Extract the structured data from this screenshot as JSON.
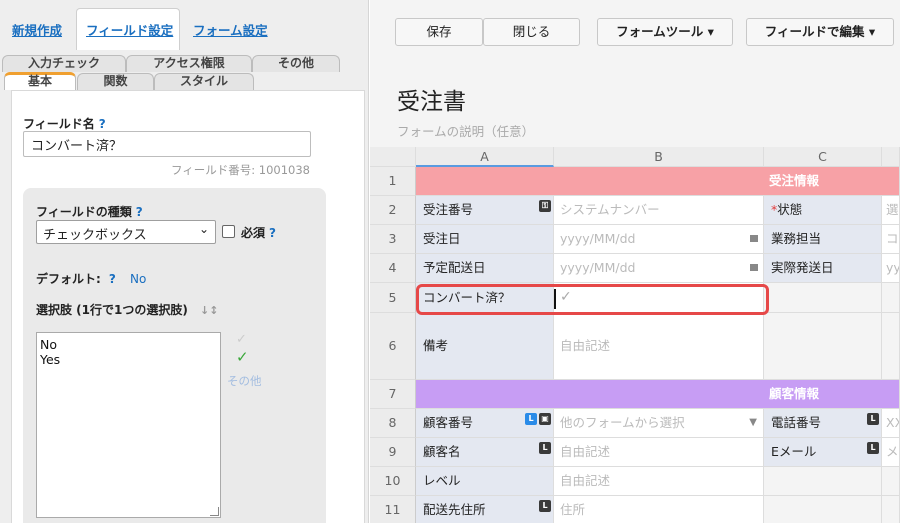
{
  "nav": {
    "new": "新規作成",
    "field_settings": "フィールド設定",
    "form_settings": "フォーム設定"
  },
  "tabs": {
    "input_check": "入力チェック",
    "access": "アクセス権限",
    "other": "その他",
    "basic": "基本",
    "function": "関数",
    "style": "スタイル"
  },
  "field": {
    "name_label": "フィールド名",
    "help": "?",
    "name_value": "コンバート済？",
    "number_text": "フィールド番号: 1001038",
    "type_label": "フィールドの種類",
    "type_value": "チェックボックス",
    "required_label": "必須",
    "default_label": "デフォルト:",
    "default_value": "No",
    "choices_label": "選択肢 (1行で1つの選択肢)",
    "choices_text": "No\nYes",
    "check_mark": "✓",
    "other_label": "その他"
  },
  "toolbar": {
    "save": "保存",
    "close": "閉じる",
    "form_tools": "フォームツール ▾",
    "edit_by_field": "フィールドで編集 ▾"
  },
  "form": {
    "title": "受注書",
    "description": "フォームの説明（任意）"
  },
  "grid": {
    "cols": [
      "A",
      "B",
      "C"
    ],
    "rows": [
      "1",
      "2",
      "3",
      "4",
      "5",
      "6",
      "7",
      "8",
      "9",
      "10",
      "11"
    ],
    "section1": "受注情報",
    "section2": "顧客情報",
    "r2": {
      "label": "受注番号",
      "value": "システムナンバー",
      "c_star": "*",
      "c_label": "状態",
      "d": "選"
    },
    "r3": {
      "label": "受注日",
      "value": "yyyy/MM/dd",
      "c_label": "業務担当",
      "d": "コ"
    },
    "r4": {
      "label": "予定配送日",
      "value": "yyyy/MM/dd",
      "c_label": "実際発送日",
      "d": "yy"
    },
    "r5": {
      "label": "コンバート済？",
      "value": "✓"
    },
    "r6": {
      "label": "備考",
      "value": "自由記述"
    },
    "r8": {
      "label": "顧客番号",
      "value": "他のフォームから選択",
      "c_label": "電話番号",
      "d": "XX"
    },
    "r9": {
      "label": "顧客名",
      "value": "自由記述",
      "c_label": "Eメール",
      "d": "メ"
    },
    "r10": {
      "label": "レベル",
      "value": "自由記述"
    },
    "r11": {
      "label": "配送先住所",
      "value": "住所"
    },
    "badge_L": "L"
  },
  "colors": {
    "link": "#1a6fc0",
    "section1": "#f7a1a6",
    "section2": "#c79df4",
    "highlight": "#e64848",
    "check": "#3aa83a"
  }
}
